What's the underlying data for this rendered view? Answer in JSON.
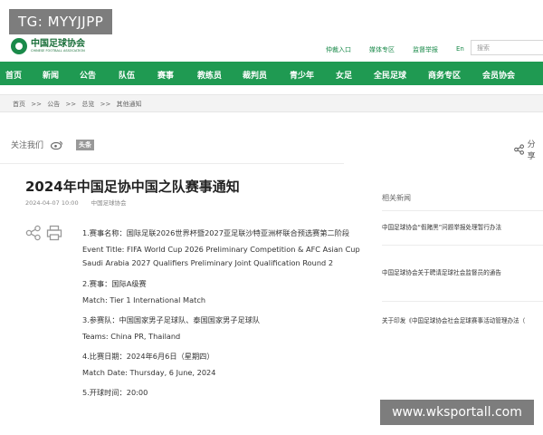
{
  "watermarks": {
    "top_left": "TG: MYYJJPP",
    "bottom_right": "www.wksportall.com"
  },
  "header": {
    "logo_cn": "中国足球协会",
    "logo_en": "CHINESE FOOTBALL ASSOCIATION",
    "util_links": [
      "仲裁入口",
      "媒体专区",
      "监督举报",
      "En"
    ],
    "search_placeholder": "搜索"
  },
  "nav": {
    "items": [
      "首页",
      "新闻",
      "公告",
      "队伍",
      "赛事",
      "教练员",
      "裁判员",
      "青少年",
      "女足",
      "全民足球",
      "商务专区",
      "会员协会"
    ]
  },
  "breadcrumb": [
    "首页",
    ">>",
    "公告",
    ">>",
    "总览",
    ">>",
    "其他通知"
  ],
  "social": {
    "follow_label": "关注我们",
    "toutiao_label": "头条",
    "share_label": "分享"
  },
  "article": {
    "title": "2024年中国足协中国之队赛事通知",
    "date": "2024-04-07 10:00",
    "source": "中国足球协会",
    "lines": [
      "1.赛事名称：国际足联2026世界杯暨2027亚足联沙特亚洲杯联合预选赛第二阶段",
      "Event Title: FIFA World Cup 2026 Preliminary Competition & AFC Asian Cup",
      "Saudi Arabia 2027 Qualifiers Preliminary Joint Qualification Round 2",
      "2.赛事：国际A级赛",
      "Match: Tier 1 International Match",
      "3.参赛队：中国国家男子足球队、泰国国家男子足球队",
      "Teams: China PR, Thailand",
      "4.比赛日期：2024年6月6日（星期四）",
      "Match Date: Thursday, 6 June, 2024",
      "5.开球时间：20:00"
    ]
  },
  "related": {
    "title": "相关新闻",
    "items": [
      "中国足球协会“假赌黑”问题举报处理暂行办法",
      "中国足球协会关于聘请足球社会监督员的通告",
      "关于印发《中国足球协会社会足球赛事活动管理办法（"
    ]
  },
  "colors": {
    "brand_green": "#1f9a52",
    "logo_green": "#1a6f3a"
  }
}
